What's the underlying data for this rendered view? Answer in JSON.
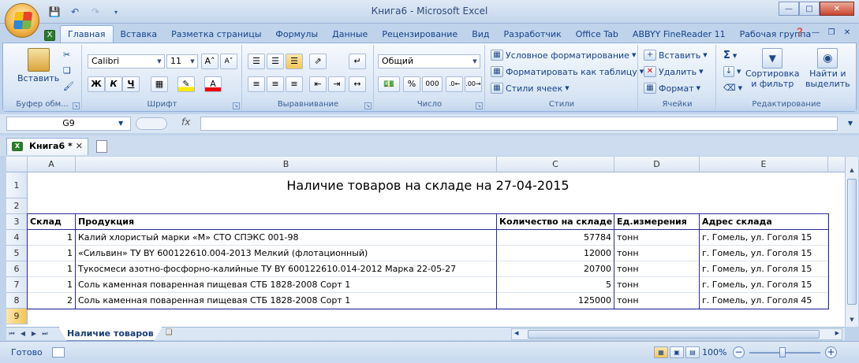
{
  "window": {
    "title": "Книга6 - Microsoft Excel"
  },
  "qat": {
    "save": "save-icon",
    "undo": "undo-icon",
    "redo": "redo-icon"
  },
  "tabs": [
    "Главная",
    "Вставка",
    "Разметка страницы",
    "Формулы",
    "Данные",
    "Рецензирование",
    "Вид",
    "Разработчик",
    "Office Tab",
    "ABBYY FineReader 11",
    "Рабочая группа"
  ],
  "ribbon": {
    "clipboard": {
      "paste": "Вставить",
      "label": "Буфер обм..."
    },
    "font": {
      "name": "Calibri",
      "size": "11",
      "label": "Шрифт",
      "bold": "Ж",
      "italic": "К",
      "underline": "Ч"
    },
    "alignment": {
      "label": "Выравнивание"
    },
    "number": {
      "format": "Общий",
      "label": "Число",
      "percent": "%",
      "thousands": "000"
    },
    "styles": {
      "conditional": "Условное форматирование",
      "as_table": "Форматировать как таблицу",
      "cell_styles": "Стили ячеек",
      "label": "Стили"
    },
    "cells": {
      "insert": "Вставить",
      "delete": "Удалить",
      "format": "Формат",
      "label": "Ячейки"
    },
    "editing": {
      "sort_l1": "Сортировка",
      "sort_l2": "и фильтр",
      "find_l1": "Найти и",
      "find_l2": "выделить",
      "label": "Редактирование"
    }
  },
  "formula_bar": {
    "name_box": "G9",
    "fx": "fx",
    "value": ""
  },
  "workbook_tab": {
    "name": "Книга6 *"
  },
  "columns": [
    "A",
    "B",
    "C",
    "D",
    "E"
  ],
  "rows": [
    "1",
    "2",
    "3",
    "4",
    "5",
    "6",
    "7",
    "8",
    "9"
  ],
  "sheet": {
    "title": "Наличие товаров на складе на 27-04-2015",
    "headers": [
      "Склад",
      "Продукция",
      "Количество на складе",
      "Ед.измерения",
      "Адрес склада"
    ],
    "data": [
      [
        "1",
        "Калий хлористый марки «М» СТО СПЭКС 001-98",
        "57784",
        "тонн",
        "г. Гомель, ул. Гоголя 15"
      ],
      [
        "1",
        "«Сильвин» ТУ BY 600122610.004-2013 Мелкий (флотационный)",
        "12000",
        "тонн",
        "г. Гомель, ул. Гоголя 15"
      ],
      [
        "1",
        "Тукосмеси азотно-фосфорно-калийные  ТУ BY 600122610.014-2012  Марка 22-05-27",
        "20700",
        "тонн",
        "г. Гомель, ул. Гоголя 15"
      ],
      [
        "1",
        "Соль каменная поваренная пищевая СТБ  1828-2008 Сорт 1",
        "5",
        "тонн",
        "г. Гомель, ул. Гоголя 15"
      ],
      [
        "2",
        "Соль каменная поваренная пищевая СТБ  1828-2008 Сорт 1",
        "125000",
        "тонн",
        "г. Гомель, ул. Гоголя 45"
      ]
    ]
  },
  "sheet_tabs": {
    "active": "Наличие товаров"
  },
  "status": {
    "ready": "Готово",
    "zoom": "100%"
  }
}
